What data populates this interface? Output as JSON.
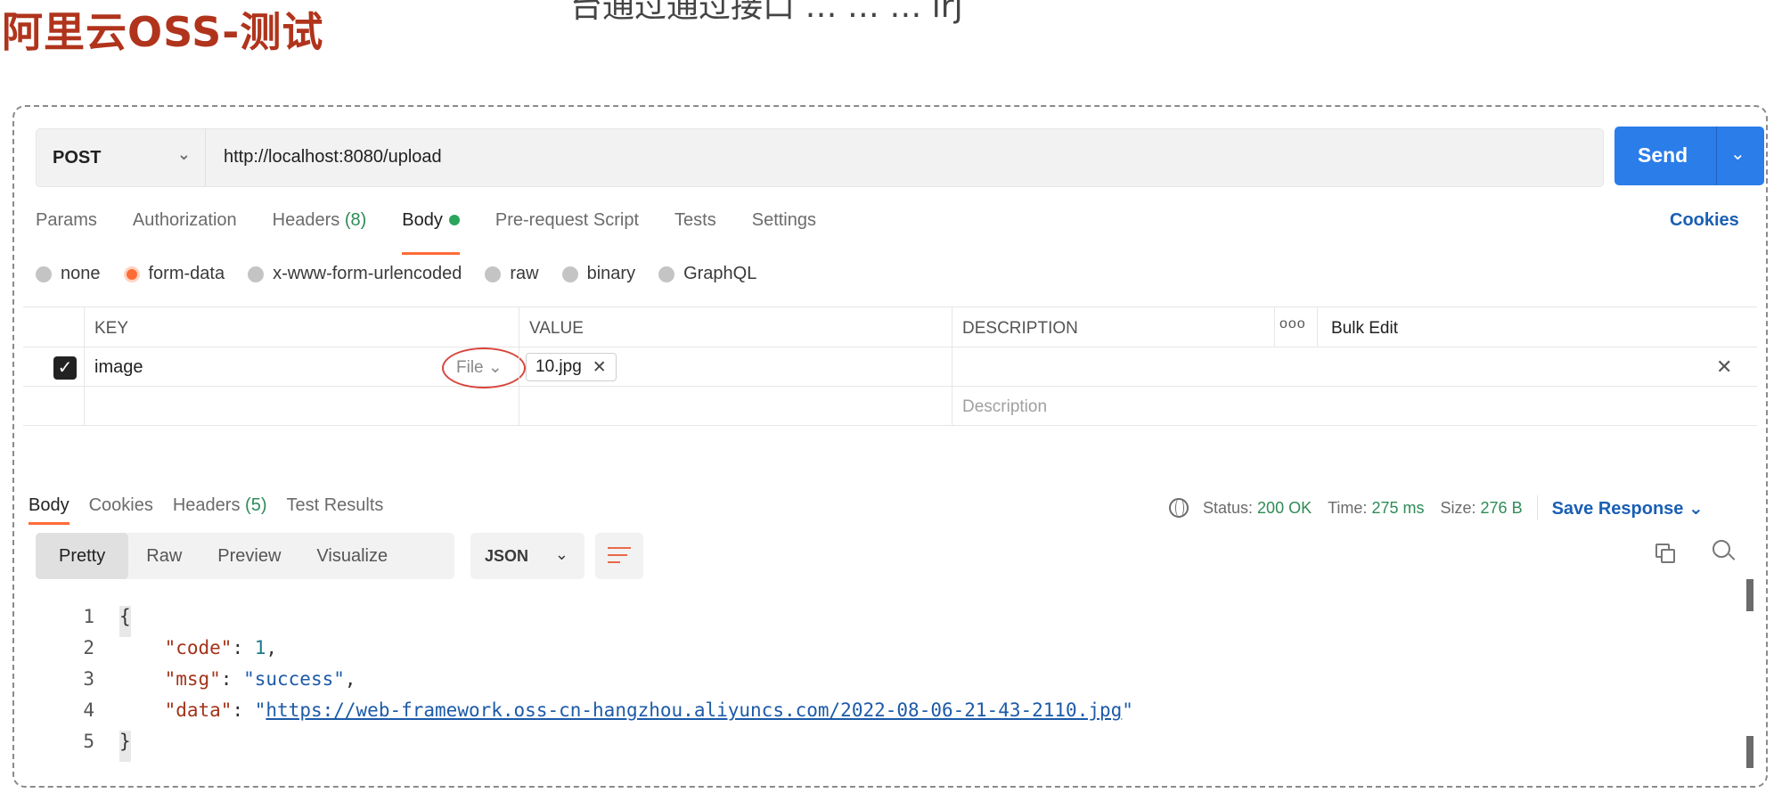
{
  "slide": {
    "title": "阿里云OSS-测试",
    "top_partial_text": "台通过通过接口  …  …  …  lrj"
  },
  "request": {
    "method": "POST",
    "url": "http://localhost:8080/upload",
    "send_label": "Send",
    "tabs": [
      {
        "label": "Params"
      },
      {
        "label": "Authorization"
      },
      {
        "label": "Headers",
        "count": "(8)"
      },
      {
        "label": "Body"
      },
      {
        "label": "Pre-request Script"
      },
      {
        "label": "Tests"
      },
      {
        "label": "Settings"
      }
    ],
    "cookies_label": "Cookies",
    "body_modes": [
      "none",
      "form-data",
      "x-www-form-urlencoded",
      "raw",
      "binary",
      "GraphQL"
    ],
    "selected_body_mode": "form-data",
    "table": {
      "headers": {
        "key": "KEY",
        "value": "VALUE",
        "description": "DESCRIPTION",
        "more": "ooo",
        "bulk_edit": "Bulk Edit"
      },
      "rows": [
        {
          "checked": true,
          "key": "image",
          "type": "File",
          "value": "10.jpg",
          "description": ""
        }
      ],
      "empty_row": {
        "description_placeholder": "Description"
      }
    }
  },
  "response": {
    "tabs": [
      {
        "label": "Body"
      },
      {
        "label": "Cookies"
      },
      {
        "label": "Headers",
        "count": "(5)"
      },
      {
        "label": "Test Results"
      }
    ],
    "status_label": "Status:",
    "status_value": "200 OK",
    "time_label": "Time:",
    "time_value": "275 ms",
    "size_label": "Size:",
    "size_value": "276 B",
    "save_response_label": "Save Response",
    "view_modes": [
      "Pretty",
      "Raw",
      "Preview",
      "Visualize"
    ],
    "active_view": "Pretty",
    "format": "JSON",
    "lines": {
      "n1": "1",
      "n2": "2",
      "n3": "3",
      "n4": "4",
      "n5": "5",
      "open": "{",
      "close": "}",
      "code_key": "\"code\"",
      "code_val": "1",
      "msg_key": "\"msg\"",
      "msg_val": "\"success\"",
      "data_key": "\"data\"",
      "data_url": "https://web-framework.oss-cn-hangzhou.aliyuncs.com/2022-08-06-21-43-2110.jpg"
    }
  },
  "colors": {
    "title": "#b0341c",
    "send_button": "#2b7de9",
    "active_tab_underline": "#ff6c37",
    "status_ok": "#2e8b57",
    "annotation_circle": "#d9453d"
  }
}
